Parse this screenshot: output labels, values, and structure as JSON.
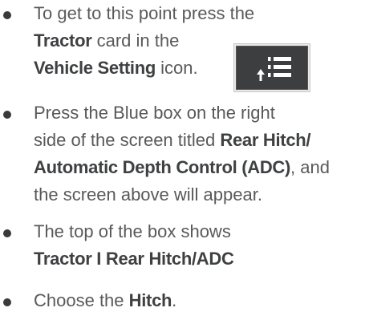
{
  "bullets": [
    {
      "lines": [
        [
          "To get to this point press the"
        ],
        [
          "",
          "Tractor",
          " card in the"
        ],
        [
          "",
          "Vehicle Setting",
          " icon."
        ]
      ]
    },
    {
      "lines": [
        [
          "Press the Blue box on the right"
        ],
        [
          "side of the screen titled ",
          "Rear Hitch/"
        ],
        [
          "",
          "Automatic Depth Control (ADC)",
          ", and"
        ],
        [
          "the screen above will appear."
        ]
      ]
    },
    {
      "lines": [
        [
          "The top of the box shows"
        ],
        [
          "",
          "Tractor I Rear Hitch/ADC"
        ]
      ]
    },
    {
      "lines": [
        [
          "Choose the ",
          "Hitch",
          "."
        ]
      ]
    }
  ],
  "icons": {
    "vehicle_setting": "vehicle-setting-icon"
  },
  "colors": {
    "text": "#58595b",
    "bold_text": "#3f4042",
    "bullet": "#3a3a3a",
    "icon_background": "#3d3e40",
    "icon_glyph": "#ffffff"
  }
}
